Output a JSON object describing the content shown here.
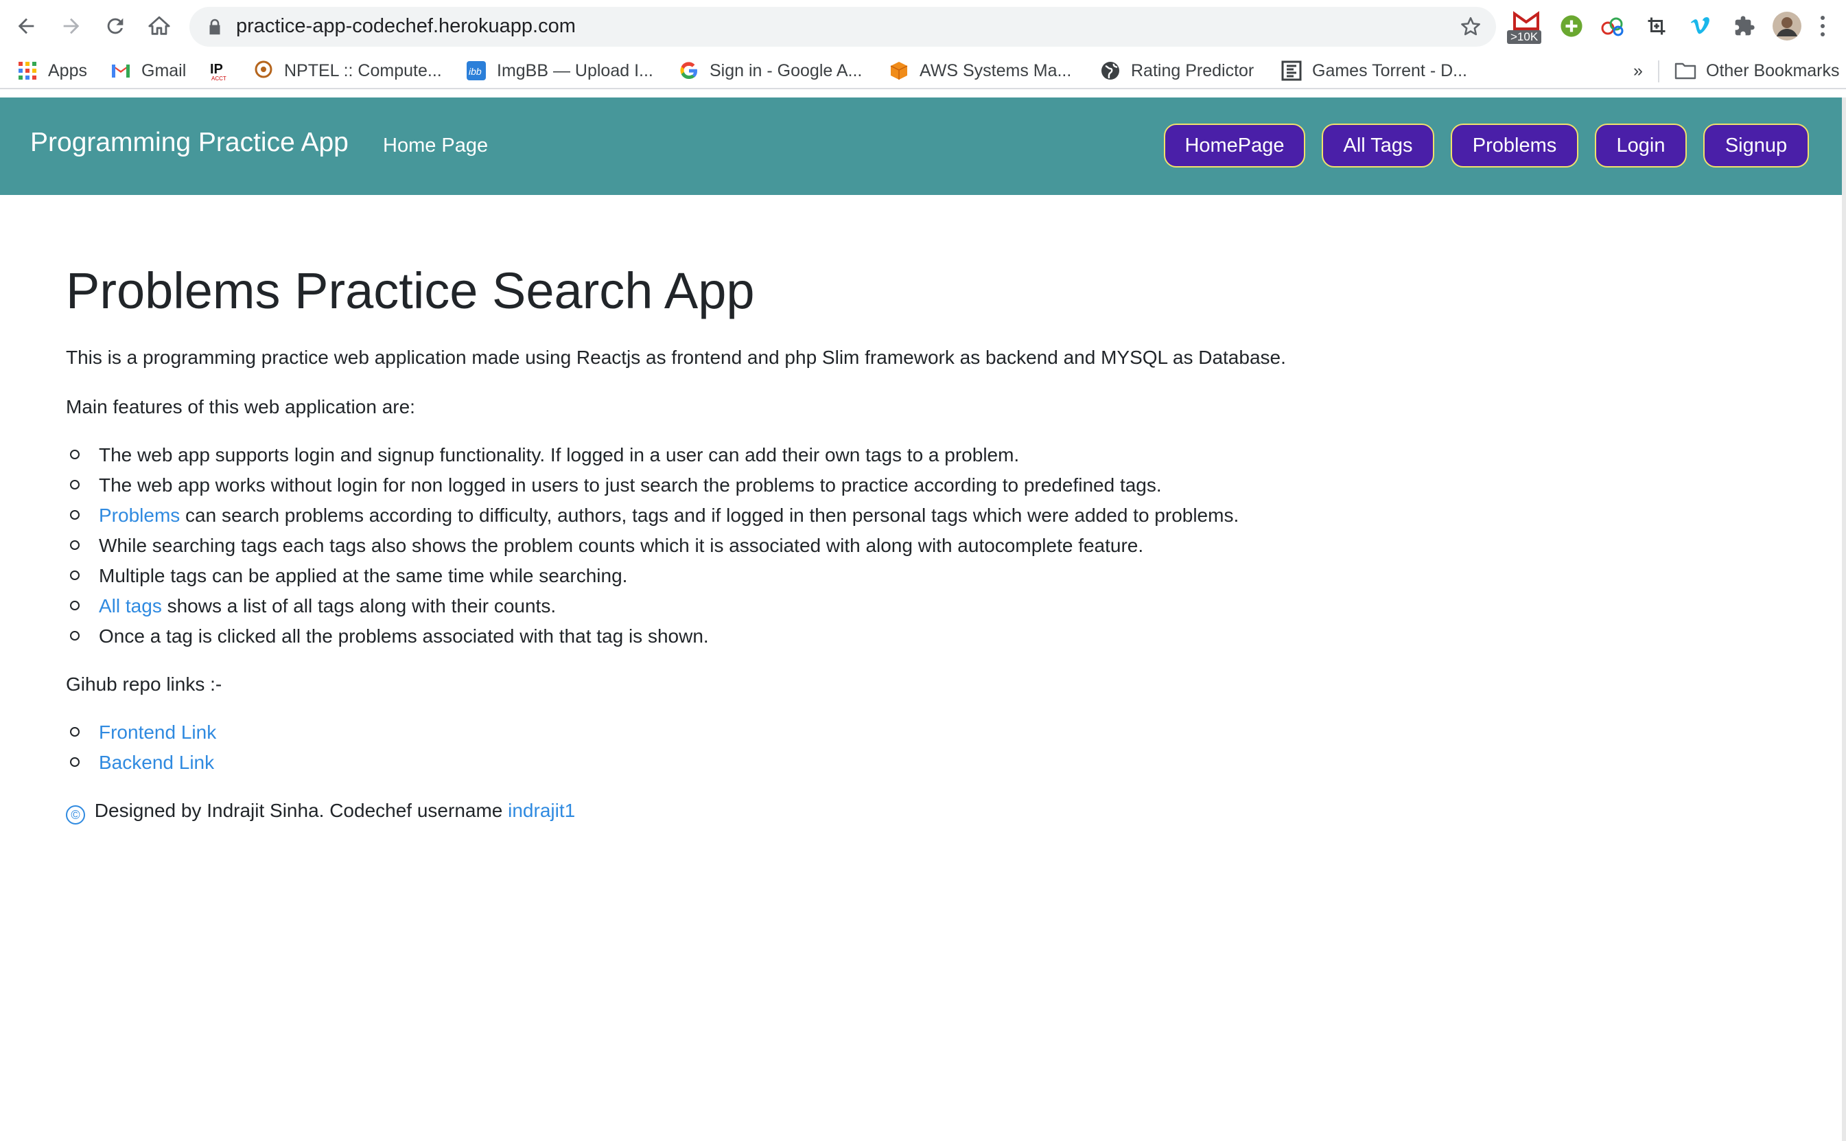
{
  "browser": {
    "url": "practice-app-codechef.herokuapp.com",
    "gmail_badge": ">10K",
    "bookmarks": [
      {
        "label": "Apps",
        "icon": "apps-grid-icon"
      },
      {
        "label": "Gmail",
        "icon": "gmail-icon"
      },
      {
        "label": "",
        "icon": "ip-acct-icon"
      },
      {
        "label": "NPTEL :: Compute...",
        "icon": "nptel-icon"
      },
      {
        "label": "ImgBB — Upload I...",
        "icon": "imgbb-icon"
      },
      {
        "label": "Sign in - Google A...",
        "icon": "google-icon"
      },
      {
        "label": "AWS Systems Ma...",
        "icon": "aws-icon"
      },
      {
        "label": "Rating Predictor",
        "icon": "globe-icon"
      },
      {
        "label": "Games Torrent - D...",
        "icon": "games-torrent-icon"
      }
    ],
    "overflow": "»",
    "other_bookmarks": "Other Bookmarks"
  },
  "header": {
    "brand": "Programming Practice App",
    "home_link": "Home Page",
    "buttons": [
      "HomePage",
      "All Tags",
      "Problems",
      "Login",
      "Signup"
    ],
    "colors": {
      "bar": "#47979a",
      "button": "#4a1fa8",
      "button_border": "#f2e16b"
    }
  },
  "main": {
    "title": "Problems Practice Search App",
    "intro": "This is a programming practice web application made using Reactjs as frontend and php Slim framework as backend and MYSQL as Database.",
    "features_heading": "Main features of this web application are:",
    "features": [
      {
        "text": "The web app supports login and signup functionality. If logged in a user can add their own tags to a problem."
      },
      {
        "text": "The web app works without login for non logged in users to just search the problems to practice according to predefined tags."
      },
      {
        "link": "Problems",
        "text": " can search problems according to difficulty, authors, tags and if logged in then personal tags which were added to problems."
      },
      {
        "text": "While searching tags each tags also shows the problem counts which it is associated with along with autocomplete feature."
      },
      {
        "text": "Multiple tags can be applied at the same time while searching."
      },
      {
        "link": "All tags",
        "text": " shows a list of all tags along with their counts."
      },
      {
        "text": "Once a tag is clicked all the problems associated with that tag is shown."
      }
    ],
    "repo_heading": "Gihub repo links :-",
    "repo_links": [
      "Frontend Link",
      "Backend Link"
    ],
    "footer_symbol": "©",
    "footer_text": " Designed by Indrajit Sinha. Codechef username ",
    "footer_user": "indrajit1",
    "link_color": "#2f8ae0"
  }
}
